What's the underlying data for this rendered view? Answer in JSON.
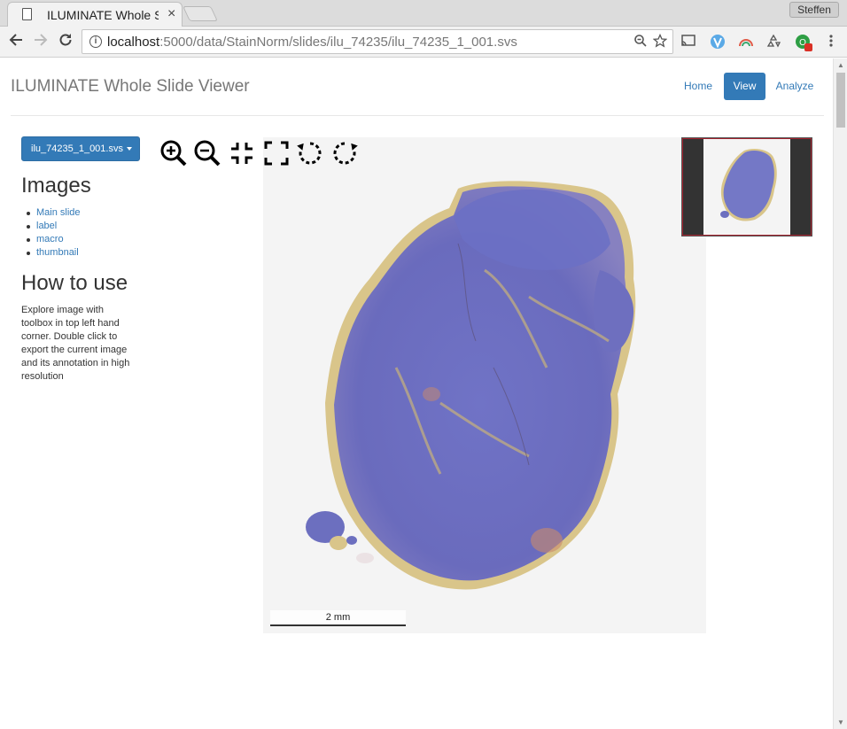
{
  "browser": {
    "tab_title": "ILUMINATE Whole Sli",
    "tab_close": "×",
    "profile_name": "Steffen",
    "url_host": "localhost",
    "url_path": ":5000/data/StainNorm/slides/ilu_74235/ilu_74235_1_001.svs",
    "extension_badge": "1"
  },
  "header": {
    "brand": "ILUMINATE Whole Slide Viewer",
    "nav": [
      {
        "label": "Home",
        "active": false
      },
      {
        "label": "View",
        "active": true
      },
      {
        "label": "Analyze",
        "active": false
      }
    ]
  },
  "sidebar": {
    "slide_select": "ilu_74235_1_001.svs",
    "images_heading": "Images",
    "images": [
      "Main slide",
      "label",
      "macro",
      "thumbnail"
    ],
    "howto_heading": "How to use",
    "howto_text": "Explore image with toolbox in top left hand corner. Double click to export the current image and its annotation in high resolution"
  },
  "viewer": {
    "tools": [
      "zoom-in-icon",
      "zoom-out-icon",
      "home-icon",
      "fullpage-icon",
      "rotate-left-icon",
      "rotate-right-icon"
    ],
    "scale_label": "2 mm",
    "colors": {
      "tissue": "#6a6fbf",
      "stroma": "#d9c58a",
      "background": "#f4f4f4",
      "nav_border": "#a3222e"
    }
  }
}
